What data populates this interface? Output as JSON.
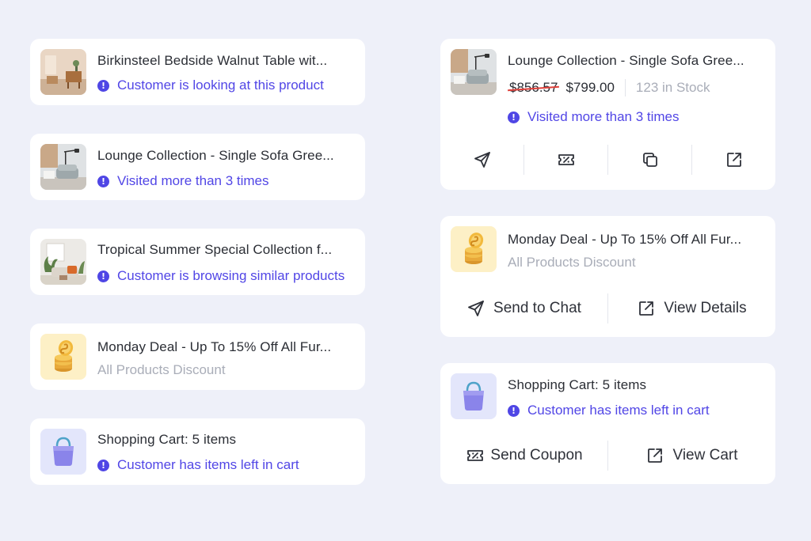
{
  "colors": {
    "background": "#eef0f9",
    "card": "#ffffff",
    "accent": "#5146e6",
    "muted": "#a9adb8",
    "strike": "#e0403a"
  },
  "left_cards": [
    {
      "title": "Birkinsteel Bedside Walnut Table wit...",
      "status": "Customer is looking at this product",
      "thumb": "bedside-table-photo"
    },
    {
      "title": "Lounge Collection - Single Sofa Gree...",
      "status": "Visited more than 3 times",
      "thumb": "sofa-lamp-photo"
    },
    {
      "title": "Tropical Summer Special Collection f...",
      "status": "Customer is browsing similar products",
      "thumb": "living-room-photo"
    },
    {
      "title": "Monday Deal - Up To 15% Off All Fur...",
      "subtitle": "All Products Discount",
      "thumb": "coin-stack-icon"
    },
    {
      "title": "Shopping Cart: 5 items",
      "status": "Customer has items left in cart",
      "thumb": "shopping-bag-icon"
    }
  ],
  "product_card": {
    "title": "Lounge Collection - Single Sofa Gree...",
    "old_price": "$856.57",
    "new_price": "$799.00",
    "stock": "123 in Stock",
    "status": "Visited more than 3 times",
    "actions": [
      "send-icon",
      "coupon-icon",
      "copy-icon",
      "external-link-icon"
    ]
  },
  "deal_card": {
    "title": "Monday Deal - Up To 15% Off All Fur...",
    "subtitle": "All Products Discount",
    "send_label": "Send to Chat",
    "view_label": "View Details"
  },
  "cart_card": {
    "title": "Shopping Cart: 5 items",
    "status": "Customer has items left in cart",
    "coupon_label": "Send Coupon",
    "view_label": "View Cart"
  }
}
